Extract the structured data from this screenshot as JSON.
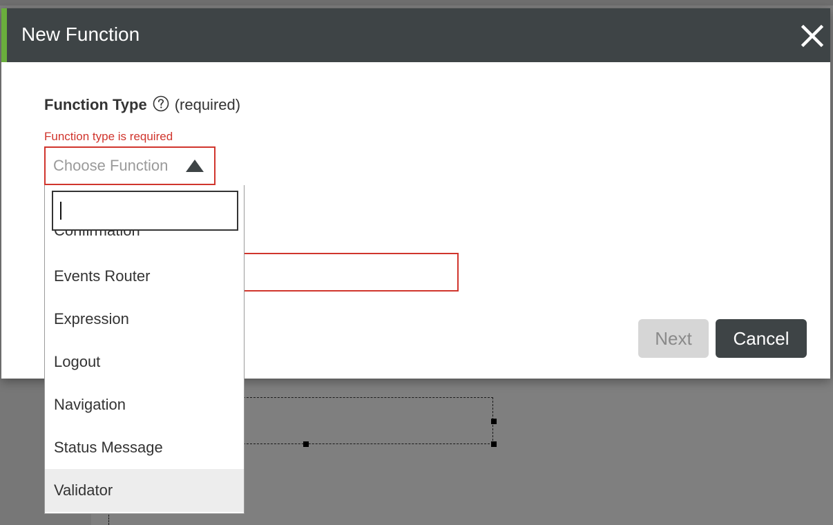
{
  "dialog": {
    "title": "New Function"
  },
  "function_type": {
    "label": "Function Type",
    "required": "(required)",
    "error": "Function type is required",
    "placeholder": "Choose Function"
  },
  "dropdown": {
    "search_value": "",
    "clipped_option": "Confirmation",
    "options": [
      {
        "label": "Events Router"
      },
      {
        "label": "Expression"
      },
      {
        "label": "Logout"
      },
      {
        "label": "Navigation"
      },
      {
        "label": "Status Message"
      },
      {
        "label": "Validator"
      }
    ],
    "highlighted": "Validator"
  },
  "buttons": {
    "next": "Next",
    "cancel": "Cancel"
  },
  "icons": {
    "close": "close-icon",
    "help": "help-icon",
    "arrow": "triangle-up-icon"
  },
  "colors": {
    "header": "#3e4446",
    "accent": "#6aae3c",
    "error": "#d0342c"
  }
}
